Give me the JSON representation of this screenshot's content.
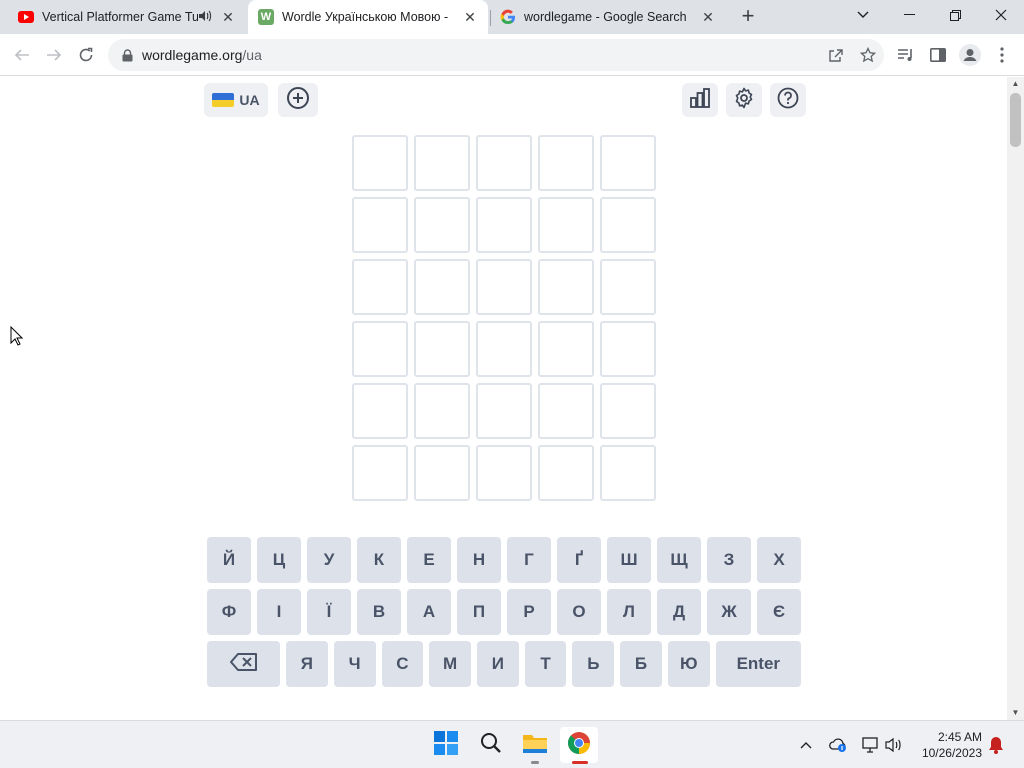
{
  "browser": {
    "tabs": [
      {
        "title": "Vertical Platformer Game Tu",
        "favicon": "youtube-icon",
        "audio": true,
        "active": false
      },
      {
        "title": "Wordle Українською Мовою -  ",
        "favicon": "wordle-w-icon",
        "favicon_letter": "W",
        "active": true
      },
      {
        "title": "wordlegame - Google Search",
        "favicon": "google-icon",
        "active": false
      }
    ],
    "address": {
      "domain": "wordlegame.org",
      "path": "/ua"
    }
  },
  "page": {
    "language": {
      "code": "UA",
      "icon": "ukraine-flag-icon"
    },
    "board": {
      "rows": 6,
      "cols": 5
    },
    "keyboard": {
      "row1": [
        "Й",
        "Ц",
        "У",
        "К",
        "Е",
        "Н",
        "Г",
        "Ґ",
        "Ш",
        "Щ",
        "З",
        "Х"
      ],
      "row2": [
        "Ф",
        "І",
        "Ї",
        "В",
        "А",
        "П",
        "Р",
        "О",
        "Л",
        "Д",
        "Ж",
        "Є"
      ],
      "row3": [
        "Я",
        "Ч",
        "С",
        "М",
        "И",
        "Т",
        "Ь",
        "Б",
        "Ю"
      ],
      "enter_label": "Enter"
    },
    "colors": {
      "tile_border": "#dfe3ea",
      "key_bg": "#dde1ea",
      "key_text": "#4a5468"
    }
  },
  "taskbar": {
    "time": "2:45 AM",
    "date": "10/26/2023"
  }
}
